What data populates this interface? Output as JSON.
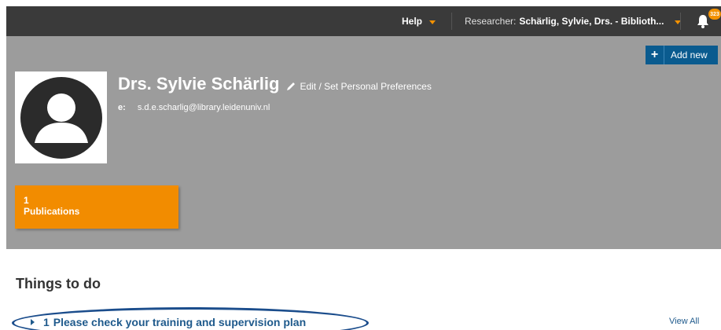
{
  "topbar": {
    "help_label": "Help",
    "researcher_prefix": "Researcher:",
    "researcher_name": "Schärlig, Sylvie, Drs. - Biblioth...",
    "notification_count": "323"
  },
  "profile": {
    "add_new_label": "Add new",
    "name": "Drs. Sylvie Schärlig",
    "edit_label": "Edit / Set Personal Preferences",
    "email_label": "e:",
    "email": "s.d.e.scharlig@library.leidenuniv.nl",
    "publications": {
      "count": "1",
      "label": "Publications"
    }
  },
  "todo": {
    "title": "Things to do",
    "item": {
      "count": "1",
      "text": "Please check your training and supervision plan"
    },
    "view_all_label": "View All"
  },
  "colors": {
    "topbar_bg": "#3a3a3a",
    "profile_bg": "#9c9c9c",
    "accent_orange": "#f28c00",
    "button_blue": "#0a5b8f",
    "link_blue": "#1f5a8c",
    "annotation_circle": "#1b4d8c"
  },
  "icons": [
    "chevron-down-icon",
    "bell-icon",
    "plus-icon",
    "user-avatar-icon",
    "pencil-icon",
    "triangle-right-icon"
  ]
}
